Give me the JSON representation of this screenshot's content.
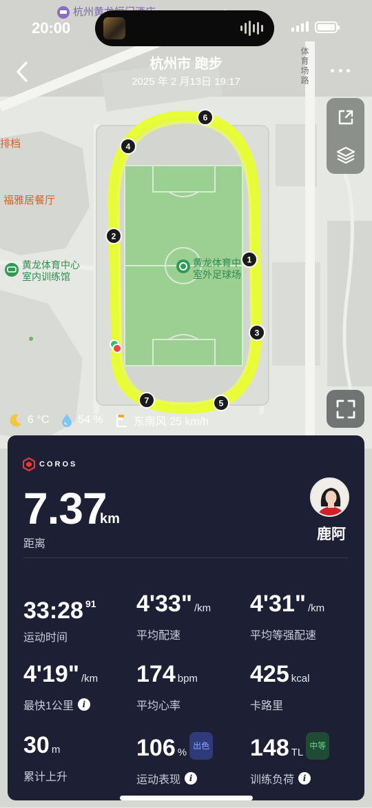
{
  "status_bar": {
    "time": "20:00"
  },
  "header": {
    "title": "杭州市 跑步",
    "datetime": "2025 年 2 月13日 19:17",
    "back_icon": "chevron-left-icon",
    "more_icon": "more-dots-icon"
  },
  "map": {
    "labels": {
      "top_poi": "杭州黄龙恒门酒店",
      "left_partial": "排档",
      "restaurant": "福雅居餐厅",
      "indoor_hall": [
        "黄龙体育中心",
        "室内训练馆"
      ],
      "outdoor_field": [
        "黄龙体育中",
        "室外足球场"
      ],
      "road": "体育场路"
    },
    "km_markers": [
      "1",
      "2",
      "3",
      "4",
      "5",
      "6",
      "7"
    ],
    "colors": {
      "track": "#e8ff2a",
      "start": "#27c46b",
      "end": "#f2453d"
    },
    "controls": {
      "share_icon": "share-icon",
      "layers_icon": "layers-icon",
      "fullscreen_icon": "fullscreen-icon"
    }
  },
  "weather": {
    "temperature": "6 °C",
    "humidity": "54 %",
    "wind": "东南风 25 km/h",
    "icons": [
      "moon-icon",
      "water-drop-icon",
      "wind-flag-icon"
    ]
  },
  "summary": {
    "brand": "COROS",
    "distance": {
      "value": "7.37",
      "unit": "km",
      "label": "距离"
    },
    "user": {
      "name": "鹿阿"
    },
    "stats": [
      {
        "value": "33:28",
        "sup": "91",
        "unit": "",
        "label": "运动时间"
      },
      {
        "value": "4'33\"",
        "unit": "/km",
        "label": "平均配速"
      },
      {
        "value": "4'31\"",
        "unit": "/km",
        "label": "平均等强配速"
      },
      {
        "value": "4'19\"",
        "unit": "/km",
        "label": "最快1公里",
        "info": true
      },
      {
        "value": "174",
        "unit": "bpm",
        "label": "平均心率"
      },
      {
        "value": "425",
        "unit": "kcal",
        "label": "卡路里"
      },
      {
        "value": "30",
        "unit": "m",
        "label": "累计上升"
      },
      {
        "value": "106",
        "unit": "%",
        "badge": "出色",
        "label": "运动表现",
        "info": true
      },
      {
        "value": "148",
        "unit": "TL",
        "badge": "中等",
        "label": "训练负荷",
        "info": true
      }
    ],
    "colors": {
      "card_bg": "#1d2035",
      "brand_red": "#e23a3a"
    }
  }
}
